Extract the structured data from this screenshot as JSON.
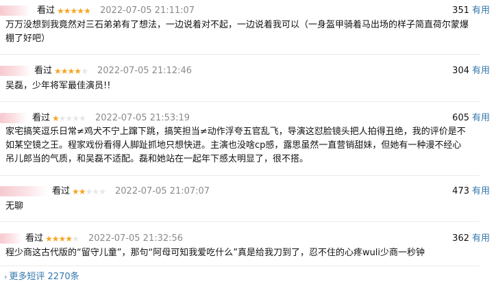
{
  "reviews": [
    {
      "status": "看过",
      "rating": 5,
      "time": "2022-07-05 21:11:07",
      "votes": "351",
      "useful_label": "有用",
      "content": "万万没想到我竟然对三石弟弟有了想法，一边说着对不起，一边说着我可以（一身盔甲骑着马出场的样子简直荷尔蒙爆棚了好吧）"
    },
    {
      "status": "看过",
      "rating": 4,
      "time": "2022-07-05 21:12:46",
      "votes": "304",
      "useful_label": "有用",
      "content": "吴磊，少年将军最佳演员!!"
    },
    {
      "status": "看过",
      "rating": 1,
      "time": "2022-07-05 21:53:19",
      "votes": "605",
      "useful_label": "有用",
      "content": "家宅搞笑逗乐日常≠鸡犬不宁上蹿下跳，搞笑担当≠动作浮夸五官乱飞，导演这怼脸镜头把人拍得丑绝，我的评价是不如某空镜之王。程家戏份看得人脚趾抓地只想快进。主演也没啥cp感，露思虽然一直营销甜妹，但她有一种漫不经心吊儿郎当的气质，和吴磊不适配。磊和她站在一起年下感太明显了，很不搭。"
    },
    {
      "status": "看过",
      "rating": 2,
      "time": "2022-07-05 21:07:07",
      "votes": "473",
      "useful_label": "有用",
      "content": "无聊"
    },
    {
      "status": "看过",
      "rating": 4,
      "time": "2022-07-05 21:32:56",
      "votes": "362",
      "useful_label": "有用",
      "content": "程少商这古代版的“留守儿童”，那句“阿母可知我爱吃什么”真是给我刀到了，忍不住的心疼wuli少商一秒钟"
    }
  ],
  "more_link": "更多短评 2270条",
  "colors": {
    "star": "#f5a623",
    "link": "#3377aa",
    "time": "#8a8a8a"
  }
}
